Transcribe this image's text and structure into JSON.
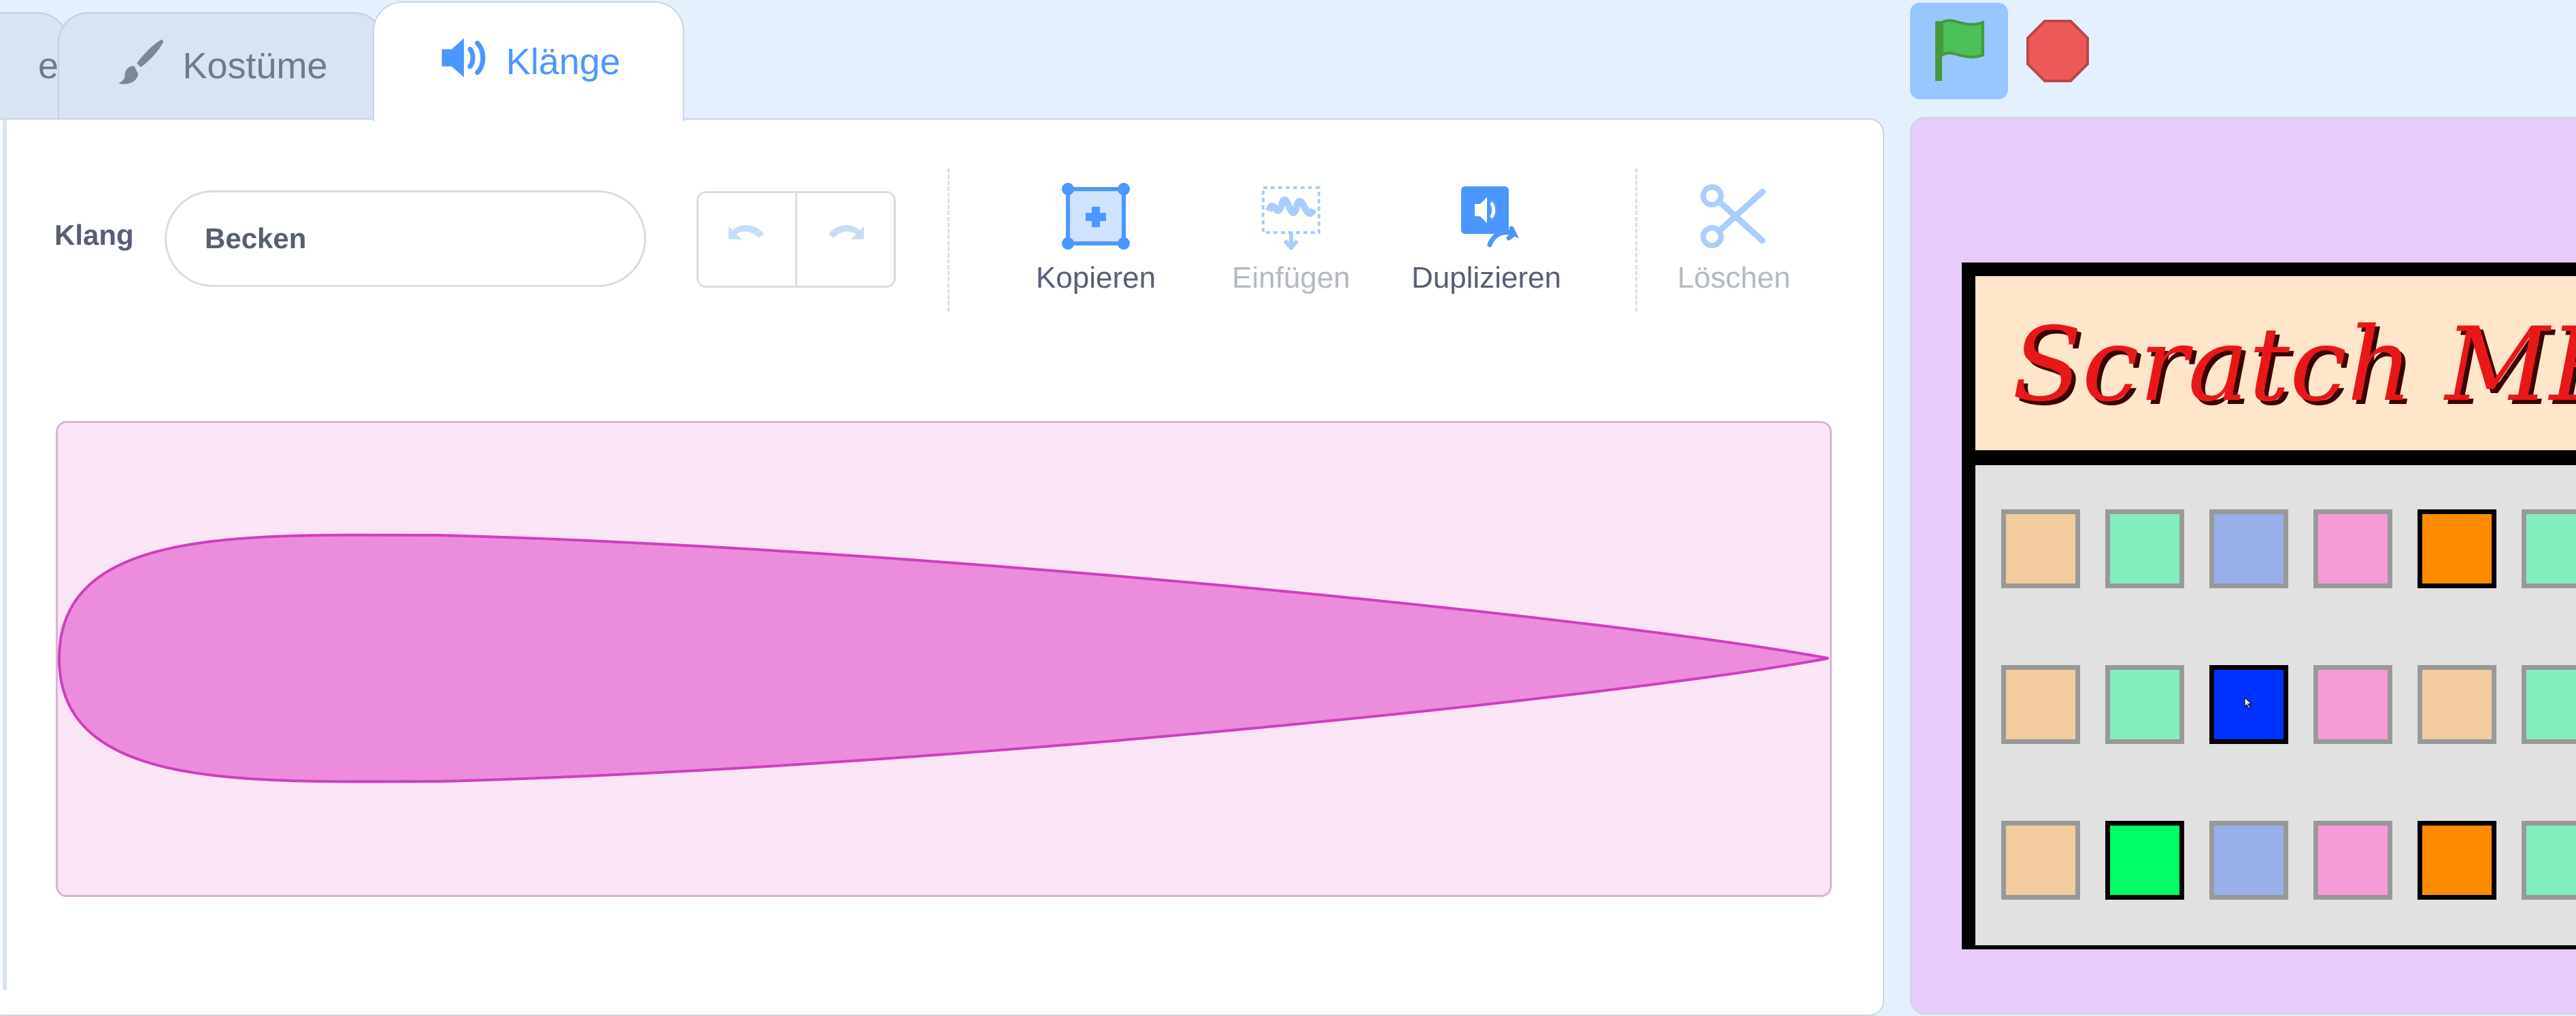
{
  "tabs": {
    "code_label": "e",
    "costumes_label": "Kostüme",
    "sounds_label": "Klänge"
  },
  "sound_editor": {
    "name_label": "Klang",
    "name_value": "Becken",
    "undo_icon": "undo-icon",
    "redo_icon": "redo-icon",
    "tools": {
      "copy_label": "Kopieren",
      "paste_label": "Einfügen",
      "duplicate_label": "Duplizieren",
      "delete_label": "Löschen"
    },
    "waveform_color": "#eb8ddc",
    "waveform_stroke": "#cf3fbd"
  },
  "controls": {
    "green_flag_icon": "green-flag-icon",
    "stop_icon": "stop-icon"
  },
  "stage": {
    "title": "Scratch MPC",
    "pad_rows": [
      [
        "#f2cc9f",
        "#83eebd",
        "#99afea",
        "#f79bd8",
        "#ff8b00",
        "#83eebd"
      ],
      [
        "#f2cc9f",
        "#83eebd",
        "#0033ff",
        "#f79bd8",
        "#f2cc9f",
        "#83eebd"
      ],
      [
        "#f2cc9f",
        "#00ff66",
        "#99afea",
        "#f79bd8",
        "#ff8b00",
        "#83eebd"
      ]
    ]
  }
}
